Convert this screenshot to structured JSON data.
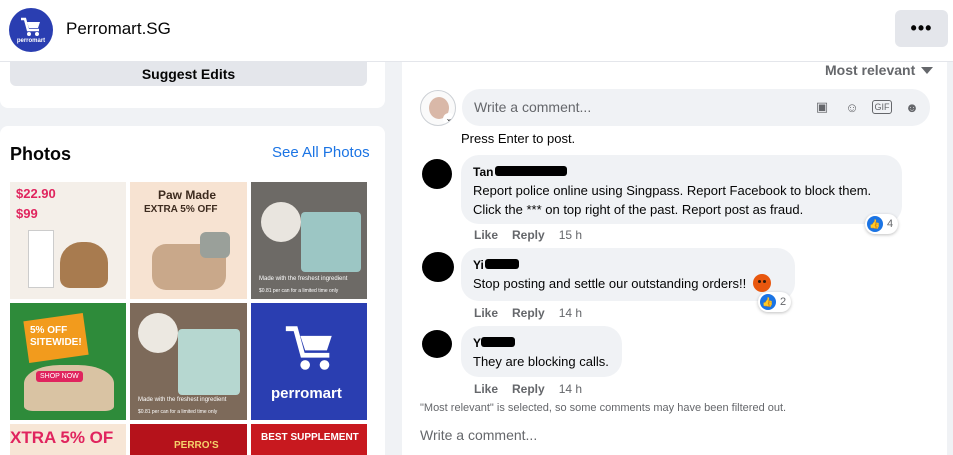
{
  "header": {
    "logo_text": "perromart",
    "page_name": "Perromart.SG",
    "more_label": "•••"
  },
  "left": {
    "suggest_edits": "Suggest Edits",
    "photos_title": "Photos",
    "see_all": "See All Photos",
    "photos": [
      {
        "caption_lines": [
          "$22.90",
          "$99"
        ]
      },
      {
        "caption_lines": [
          "Paw Made",
          "EXTRA 5% OFF"
        ]
      },
      {
        "caption_lines": [
          "Made with the freshest ingredient",
          "$0.81 per can for a limited time only"
        ]
      },
      {
        "caption_lines": [
          "5% OFF SITEWIDE!",
          "SHOP NOW"
        ]
      },
      {
        "caption_lines": [
          "Made with the freshest ingredient",
          "$0.81 per can for a limited time only"
        ]
      },
      {
        "caption_lines": [
          "perromart"
        ]
      },
      {
        "caption_lines": [
          "XTRA 5% OF"
        ]
      },
      {
        "caption_lines": [
          "PERRO'S"
        ]
      },
      {
        "caption_lines": [
          "BEST SUPPLEMENT"
        ]
      }
    ]
  },
  "comments": {
    "sort_label": "Most relevant",
    "composer_placeholder": "Write a comment...",
    "composer_tools": [
      "sticker-icon",
      "emoji-icon",
      "gif-icon",
      "avatar-sticker-icon"
    ],
    "hint": "Press Enter to post.",
    "items": [
      {
        "author": "Tan",
        "text_lines": [
          "Report police online using Singpass. Report Facebook to block them.",
          "Click the *** on top right of the past. Report post as fraud."
        ],
        "like": "Like",
        "reply": "Reply",
        "time": "15 h",
        "reaction_count": "4"
      },
      {
        "author": "Yi",
        "text_lines": [
          "Stop posting and settle our outstanding orders!!"
        ],
        "like": "Like",
        "reply": "Reply",
        "time": "14 h",
        "reaction_count": "2"
      },
      {
        "author": "Y",
        "text_lines": [
          "They are blocking calls."
        ],
        "like": "Like",
        "reply": "Reply",
        "time": "14 h"
      }
    ],
    "notice": "\"Most relevant\" is selected, so some comments may have been filtered out.",
    "write_again": "Write a comment..."
  }
}
